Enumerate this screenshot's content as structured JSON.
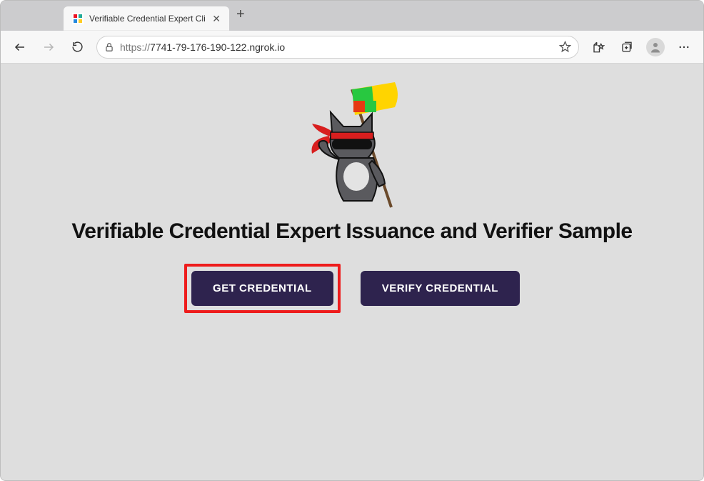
{
  "browser": {
    "tab_title": "Verifiable Credential Expert Cli",
    "url_dim_prefix": "https://",
    "url_host": "7741-79-176-190-122.ngrok.io"
  },
  "page": {
    "heading": "Verifiable Credential Expert Issuance and Verifier Sample",
    "get_button": "GET CREDENTIAL",
    "verify_button": "VERIFY CREDENTIAL"
  }
}
